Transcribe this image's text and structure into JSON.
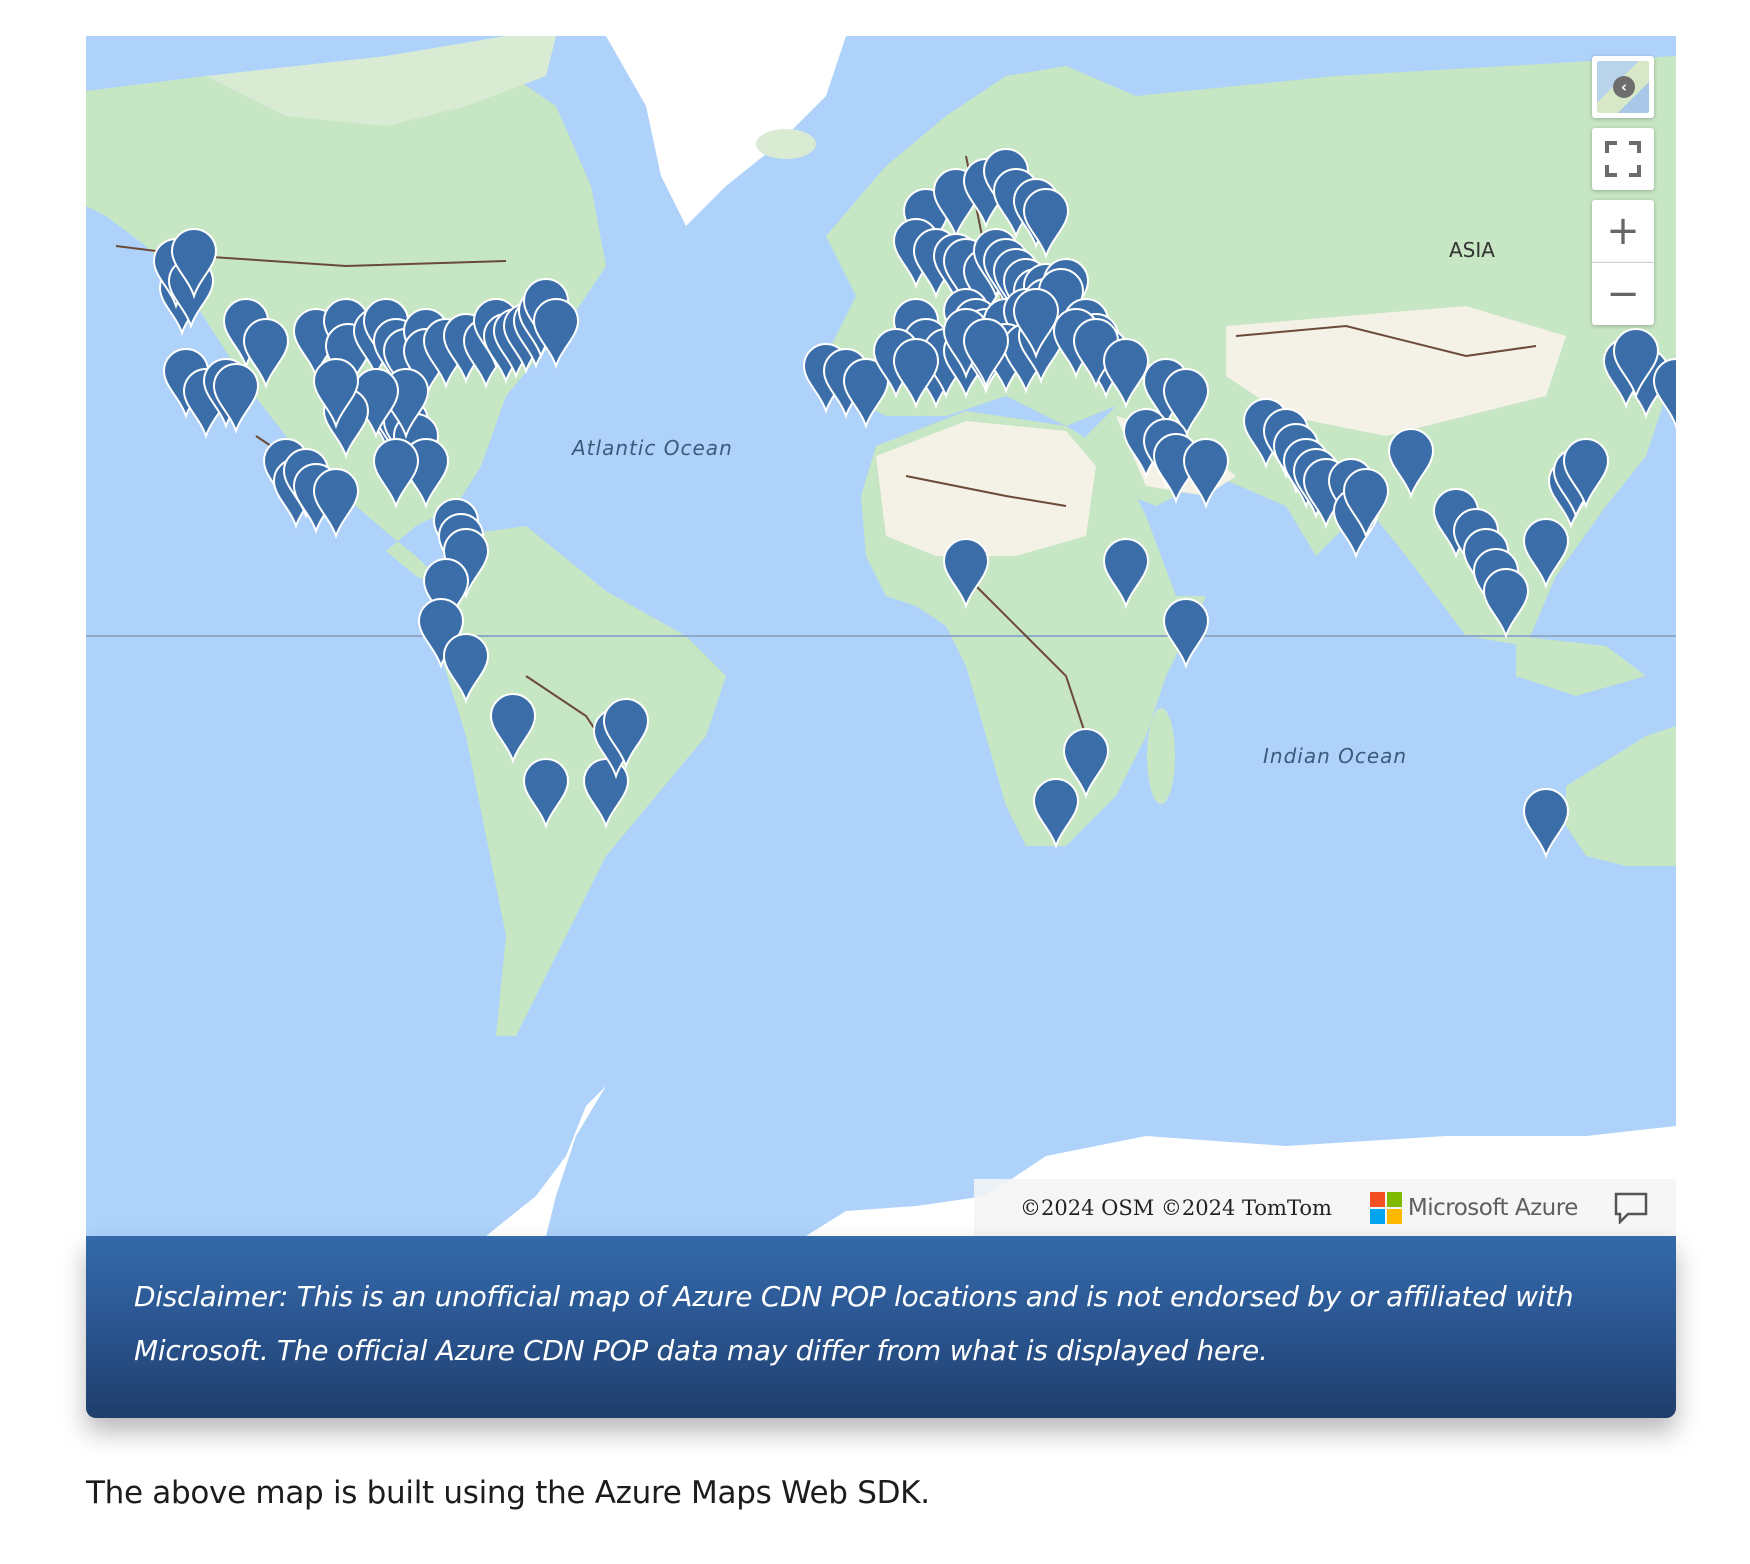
{
  "map": {
    "ocean_labels": [
      "Atlantic Ocean",
      "Indian Ocean"
    ],
    "continent_labels": [
      "ASIA"
    ],
    "marker_color": "#3b6ea8",
    "attribution": "©2024 OSM  ©2024 TomTom",
    "brand": "Microsoft Azure",
    "controls": {
      "style_picker": "map-style-picker",
      "fullscreen": "fullscreen-icon",
      "zoom_in": "+",
      "zoom_out": "−"
    },
    "ms_logo_colors": [
      "#f25022",
      "#7fba00",
      "#00a4ef",
      "#ffb900"
    ]
  },
  "disclaimer": "Disclaimer: This is an unofficial map of Azure CDN POP locations and is not endorsed by or affiliated with Microsoft. The official Azure CDN POP data may differ from what is displayed here.",
  "caption": "The above map is built using the Azure Maps Web SDK."
}
